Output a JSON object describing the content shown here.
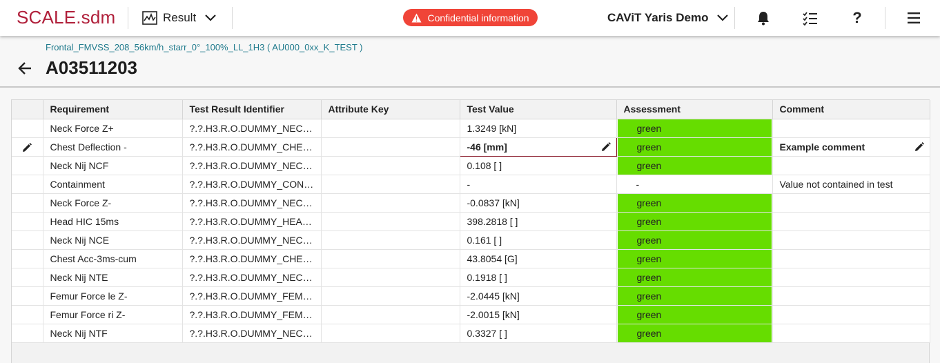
{
  "header": {
    "logo": "SCALE.sdm",
    "result_label": "Result",
    "confidential": "Confidential information",
    "project": "CAViT Yaris Demo",
    "help": "?"
  },
  "page": {
    "breadcrumb": "Frontal_FMVSS_208_56km/h_starr_0°_100%_LL_1H3 ( AU000_0xx_K_TEST )",
    "title": "A03511203"
  },
  "table": {
    "columns": [
      "Requirement",
      "Test Result Identifier",
      "Attribute Key",
      "Test Value",
      "Assessment",
      "Comment"
    ],
    "rows": [
      {
        "requirement": "Neck Force Z+",
        "identifier": "?.?.H3.R.O.DUMMY_NECK_...",
        "attribute": "",
        "value": "1.3249 [kN]",
        "assessment": "green",
        "comment": ""
      },
      {
        "requirement": "Chest Deflection -",
        "identifier": "?.?.H3.R.O.DUMMY_CHEST...",
        "attribute": "",
        "value": "-46 [mm]",
        "assessment": "green",
        "comment": "Example comment"
      },
      {
        "requirement": "Neck Nij NCF",
        "identifier": "?.?.H3.R.O.DUMMY_NECK_...",
        "attribute": "",
        "value": "0.108 [ ]",
        "assessment": "green",
        "comment": ""
      },
      {
        "requirement": "Containment",
        "identifier": "?.?.H3.R.O.DUMMY_CONTA...",
        "attribute": "",
        "value": "-",
        "assessment": "-",
        "comment": "Value not contained in test"
      },
      {
        "requirement": "Neck Force Z-",
        "identifier": "?.?.H3.R.O.DUMMY_NECK_...",
        "attribute": "",
        "value": "-0.0837 [kN]",
        "assessment": "green",
        "comment": ""
      },
      {
        "requirement": "Head HIC 15ms",
        "identifier": "?.?.H3.R.O.DUMMY_HEAD_...",
        "attribute": "",
        "value": "398.2818 [ ]",
        "assessment": "green",
        "comment": ""
      },
      {
        "requirement": "Neck Nij NCE",
        "identifier": "?.?.H3.R.O.DUMMY_NECK_...",
        "attribute": "",
        "value": "0.161 [ ]",
        "assessment": "green",
        "comment": ""
      },
      {
        "requirement": "Chest Acc-3ms-cum",
        "identifier": "?.?.H3.R.O.DUMMY_CHEST...",
        "attribute": "",
        "value": "43.8054 [G]",
        "assessment": "green",
        "comment": ""
      },
      {
        "requirement": "Neck Nij NTE",
        "identifier": "?.?.H3.R.O.DUMMY_NECK_...",
        "attribute": "",
        "value": "0.1918 [ ]",
        "assessment": "green",
        "comment": ""
      },
      {
        "requirement": "Femur Force le Z-",
        "identifier": "?.?.H3.R.O.DUMMY_FEMUR...",
        "attribute": "",
        "value": "-2.0445 [kN]",
        "assessment": "green",
        "comment": ""
      },
      {
        "requirement": "Femur Force ri Z-",
        "identifier": "?.?.H3.R.O.DUMMY_FEMUR...",
        "attribute": "",
        "value": "-2.0015 [kN]",
        "assessment": "green",
        "comment": ""
      },
      {
        "requirement": "Neck Nij NTF",
        "identifier": "?.?.H3.R.O.DUMMY_NECK_...",
        "attribute": "",
        "value": "0.3327 [ ]",
        "assessment": "green",
        "comment": ""
      }
    ]
  },
  "colors": {
    "brand": "#b01f3a",
    "confidential": "#f04438",
    "assessment_green": "#66dd00",
    "breadcrumb": "#1f7a8c"
  },
  "icons": [
    "chart-icon",
    "chevron-down-icon",
    "warning-icon",
    "bell-icon",
    "checklist-icon",
    "help-icon",
    "menu-icon",
    "back-arrow-icon",
    "pencil-icon"
  ]
}
